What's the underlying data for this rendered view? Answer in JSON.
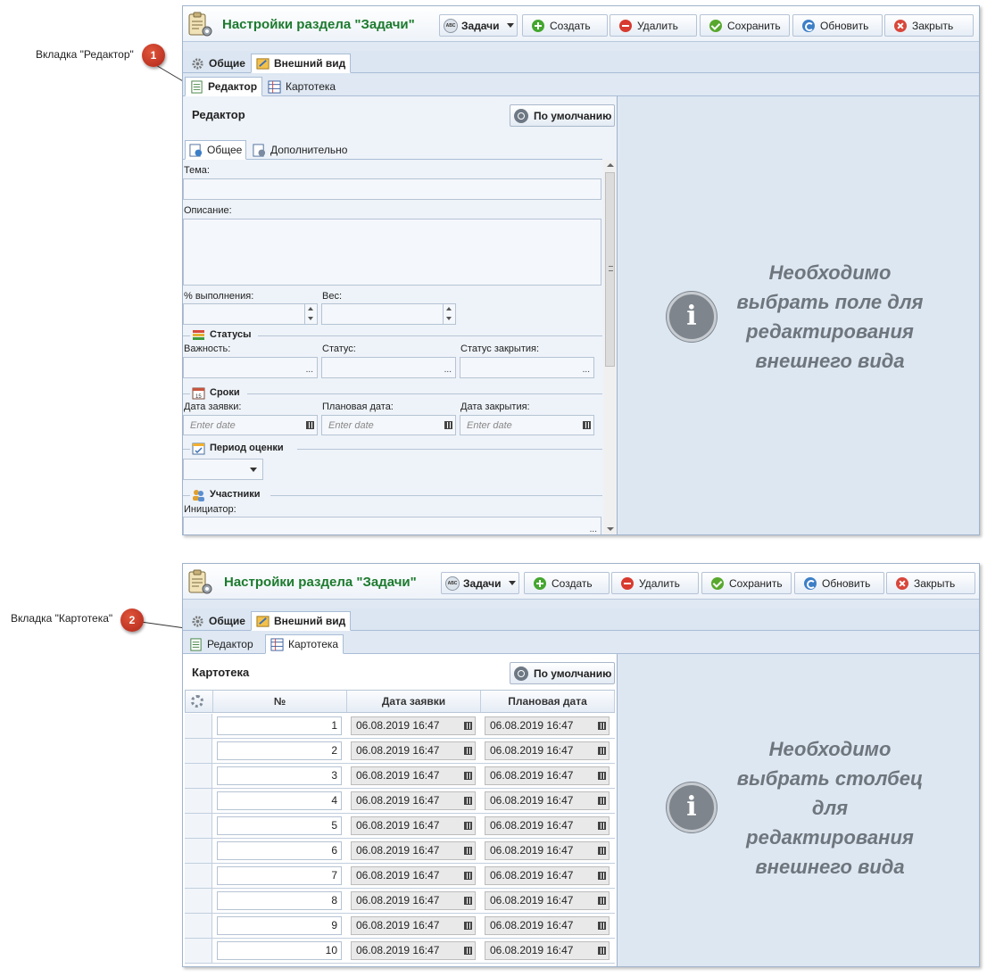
{
  "callouts": [
    {
      "label": "Вкладка \"Редактор\"",
      "num": "1"
    },
    {
      "label": "Вкладка \"Картотека\"",
      "num": "2"
    }
  ],
  "toolbar": {
    "title": "Настройки раздела \"Задачи\"",
    "dropdown_label": "Задачи",
    "create": "Создать",
    "delete": "Удалить",
    "save": "Сохранить",
    "refresh": "Обновить",
    "close": "Закрыть"
  },
  "main_tabs": {
    "general": "Общие",
    "appearance": "Внешний вид"
  },
  "sub_tabs": {
    "editor": "Редактор",
    "cardfile": "Картотека"
  },
  "default_button": "По умолчанию",
  "editor": {
    "title": "Редактор",
    "inner_tabs": {
      "general": "Общее",
      "additional": "Дополнительно"
    },
    "fields": {
      "subject": "Тема:",
      "description": "Описание:",
      "percent": "% выполнения:",
      "weight": "Вес:",
      "importance": "Важность:",
      "status": "Статус:",
      "close_status": "Статус закрытия:",
      "request_date": "Дата заявки:",
      "planned_date": "Плановая дата:",
      "close_date": "Дата закрытия:",
      "initiator": "Инициатор:"
    },
    "sections": {
      "statuses": "Статусы",
      "terms": "Сроки",
      "period": "Период оценки",
      "participants": "Участники"
    },
    "date_placeholder": "Enter date",
    "info": "Необходимо выбрать поле для редактирования внешнего вида"
  },
  "cardfile": {
    "title": "Картотека",
    "columns": {
      "num": "№",
      "request_date": "Дата заявки",
      "planned_date": "Плановая дата"
    },
    "rows": [
      {
        "num": "1",
        "request_date": "06.08.2019 16:47",
        "planned_date": "06.08.2019 16:47"
      },
      {
        "num": "2",
        "request_date": "06.08.2019 16:47",
        "planned_date": "06.08.2019 16:47"
      },
      {
        "num": "3",
        "request_date": "06.08.2019 16:47",
        "planned_date": "06.08.2019 16:47"
      },
      {
        "num": "4",
        "request_date": "06.08.2019 16:47",
        "planned_date": "06.08.2019 16:47"
      },
      {
        "num": "5",
        "request_date": "06.08.2019 16:47",
        "planned_date": "06.08.2019 16:47"
      },
      {
        "num": "6",
        "request_date": "06.08.2019 16:47",
        "planned_date": "06.08.2019 16:47"
      },
      {
        "num": "7",
        "request_date": "06.08.2019 16:47",
        "planned_date": "06.08.2019 16:47"
      },
      {
        "num": "8",
        "request_date": "06.08.2019 16:47",
        "planned_date": "06.08.2019 16:47"
      },
      {
        "num": "9",
        "request_date": "06.08.2019 16:47",
        "planned_date": "06.08.2019 16:47"
      },
      {
        "num": "10",
        "request_date": "06.08.2019 16:47",
        "planned_date": "06.08.2019 16:47"
      }
    ],
    "info": "Необходимо выбрать столбец для редактирования внешнего вида"
  },
  "colors": {
    "title_green": "#1c7a2e",
    "callout_red": "#c0392b",
    "info_gray": "#6e757c"
  }
}
